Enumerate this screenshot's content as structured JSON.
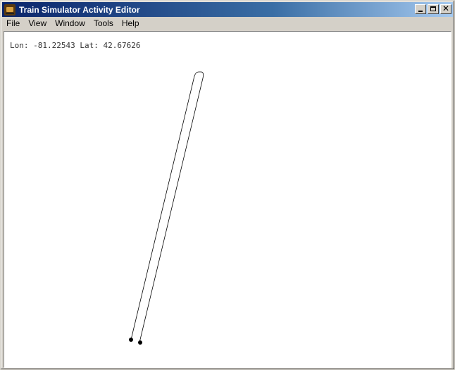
{
  "window": {
    "title": "Train Simulator Activity Editor",
    "icon": "train-app-icon"
  },
  "menu": {
    "items": [
      "File",
      "View",
      "Window",
      "Tools",
      "Help"
    ]
  },
  "map": {
    "lon_label": "Lon:",
    "lon_value": "-81.22543",
    "lat_label": "Lat:",
    "lat_value": "42.67626"
  },
  "colors": {
    "title_gradient_start": "#0a246a",
    "title_gradient_end": "#a6caf0",
    "window_face": "#d4d0c8",
    "track_line": "#000000"
  }
}
